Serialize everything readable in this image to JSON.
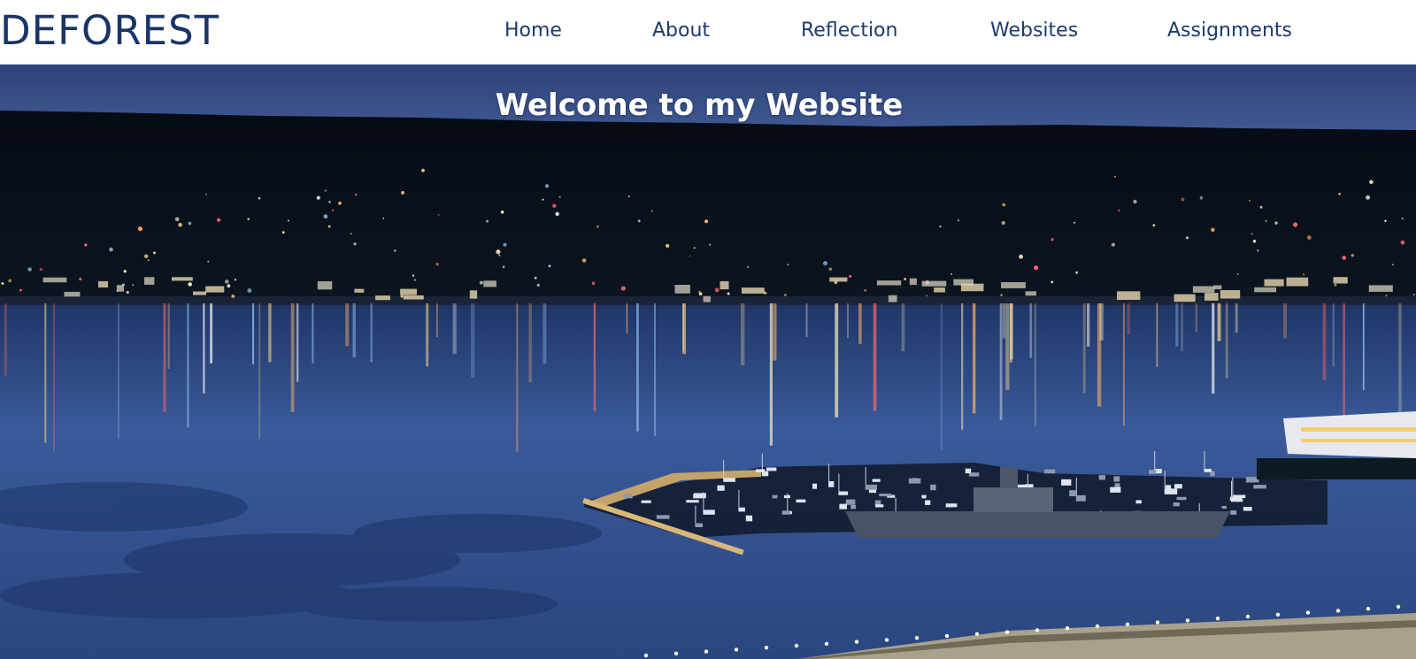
{
  "header": {
    "brand": "DEFOREST",
    "nav": [
      {
        "label": "Home"
      },
      {
        "label": "About"
      },
      {
        "label": "Reflection"
      },
      {
        "label": "Websites"
      },
      {
        "label": "Assignments"
      }
    ]
  },
  "hero": {
    "title": "Welcome to my Website",
    "image_icon": "harbor-night-photo"
  },
  "colors": {
    "brand": "#1a3466",
    "nav_text": "#1e3a6e",
    "header_bg": "#ffffff",
    "water": "#2c4a86",
    "sky": "#3b5694"
  }
}
